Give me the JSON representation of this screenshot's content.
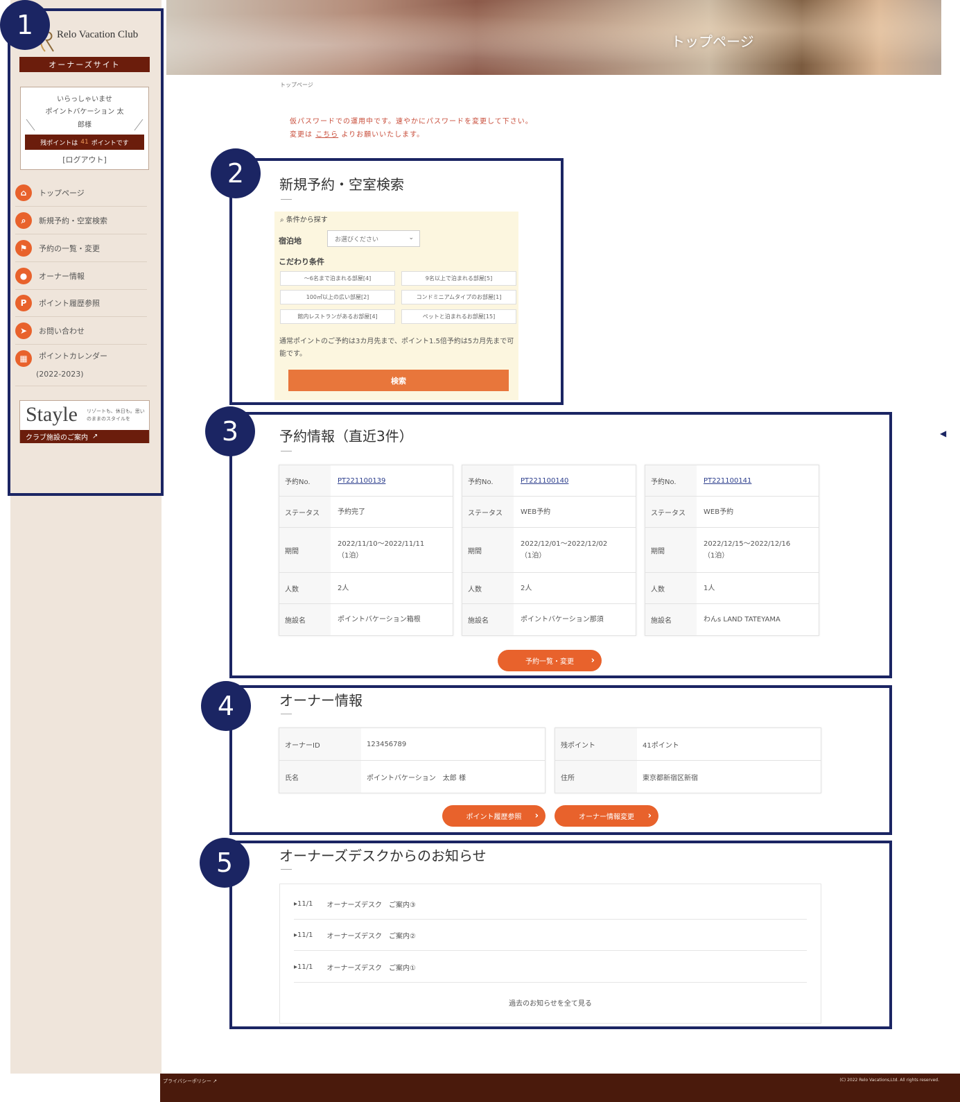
{
  "badges": [
    "1",
    "2",
    "3",
    "4",
    "5"
  ],
  "brand": {
    "logo_text": "Relo Vacation Club",
    "owner_site": "オーナーズサイト"
  },
  "welcome": {
    "line1": "いらっしゃいませ",
    "line2": "ポイントバケーション 太",
    "line3": "郎様",
    "points_prefix": "残ポイントは",
    "points_value": "41",
    "points_suffix": "ポイントです",
    "logout": "[ログアウト]"
  },
  "nav": [
    {
      "label": "トップページ",
      "icon": "home-icon",
      "glyph": "⌂"
    },
    {
      "label": "新規予約・空室検索",
      "icon": "search-icon",
      "glyph": "⌕"
    },
    {
      "label": "予約の一覧・変更",
      "icon": "flag-icon",
      "glyph": "⚑"
    },
    {
      "label": "オーナー情報",
      "icon": "person-icon",
      "glyph": "●"
    },
    {
      "label": "ポイント履歴参照",
      "icon": "point-icon",
      "glyph": "P"
    },
    {
      "label": "お問い合わせ",
      "icon": "send-icon",
      "glyph": "➤"
    },
    {
      "label": "ポイントカレンダー",
      "icon": "calendar-icon",
      "glyph": "▦"
    }
  ],
  "nav_calendar_year": "(2022-2023)",
  "stayle": {
    "logo": "Stayle",
    "sub": "リゾートも、休日も。思いのままのスタイルを",
    "link": "クラブ施設のご案内"
  },
  "hero": {
    "title": "トップページ"
  },
  "breadcrumb": "トップページ",
  "alert": {
    "line1": "仮パスワードでの運用中です。速やかにパスワードを変更して下さい。",
    "line2_prefix": "変更は",
    "line2_link": "こちら",
    "line2_suffix": "よりお願いいたします。"
  },
  "search": {
    "title": "新規予約・空室検索",
    "condition_label": "条件から探す",
    "lodging_label": "宿泊地",
    "lodging_placeholder": "お選びください",
    "pref_label": "こだわり条件",
    "pref_options": [
      "～6名まで泊まれる部屋[4]",
      "9名以上で泊まれる部屋[5]",
      "100㎡以上の広い部屋[2]",
      "コンドミニアムタイプのお部屋[1]",
      "館内レストランがあるお部屋[4]",
      "ペットと泊まれるお部屋[15]"
    ],
    "note": "通常ポイントのご予約は3カ月先まで、ポイント1.5倍予約は5カ月先まで可能です。",
    "button": "検索"
  },
  "reservations": {
    "title": "予約情報（直近3件）",
    "labels": {
      "no": "予約No.",
      "status": "ステータス",
      "period": "期間",
      "people": "人数",
      "facility": "施設名"
    },
    "items": [
      {
        "no": "PT221100139",
        "status": "予約完了",
        "period": "2022/11/10～2022/11/11",
        "nights": "（1泊）",
        "people": "2人",
        "facility": "ポイントバケーション箱根"
      },
      {
        "no": "PT221100140",
        "status": "WEB予約",
        "period": "2022/12/01～2022/12/02",
        "nights": "（1泊）",
        "people": "2人",
        "facility": "ポイントバケーション那須"
      },
      {
        "no": "PT221100141",
        "status": "WEB予約",
        "period": "2022/12/15～2022/12/16",
        "nights": "（1泊）",
        "people": "1人",
        "facility": "わんs LAND TATEYAMA"
      }
    ],
    "button": "予約一覧・変更"
  },
  "owner": {
    "title": "オーナー情報",
    "id_label": "オーナーID",
    "id_value": "123456789",
    "name_label": "氏名",
    "name_value": "ポイントバケーション　太郎 様",
    "points_label": "残ポイント",
    "points_value": "41ポイント",
    "address_label": "住所",
    "address_value": "東京都新宿区新宿",
    "button_points": "ポイント履歴参照",
    "button_edit": "オーナー情報変更"
  },
  "news": {
    "title": "オーナーズデスクからのお知らせ",
    "items": [
      {
        "date": "▸11/1",
        "text": "オーナーズデスク　ご案内③"
      },
      {
        "date": "▸11/1",
        "text": "オーナーズデスク　ご案内②"
      },
      {
        "date": "▸11/1",
        "text": "オーナーズデスク　ご案内①"
      }
    ],
    "more": "過去のお知らせを全て見る"
  },
  "footer": {
    "privacy": "プライバシーポリシー",
    "copyright": "(C) 2022 Relo Vacations,Ltd. All rights reserved."
  },
  "colors": {
    "navy": "#1b2563",
    "accent": "#e8622c",
    "maroon": "#6b1d0c",
    "sidebar": "#efe5db"
  }
}
